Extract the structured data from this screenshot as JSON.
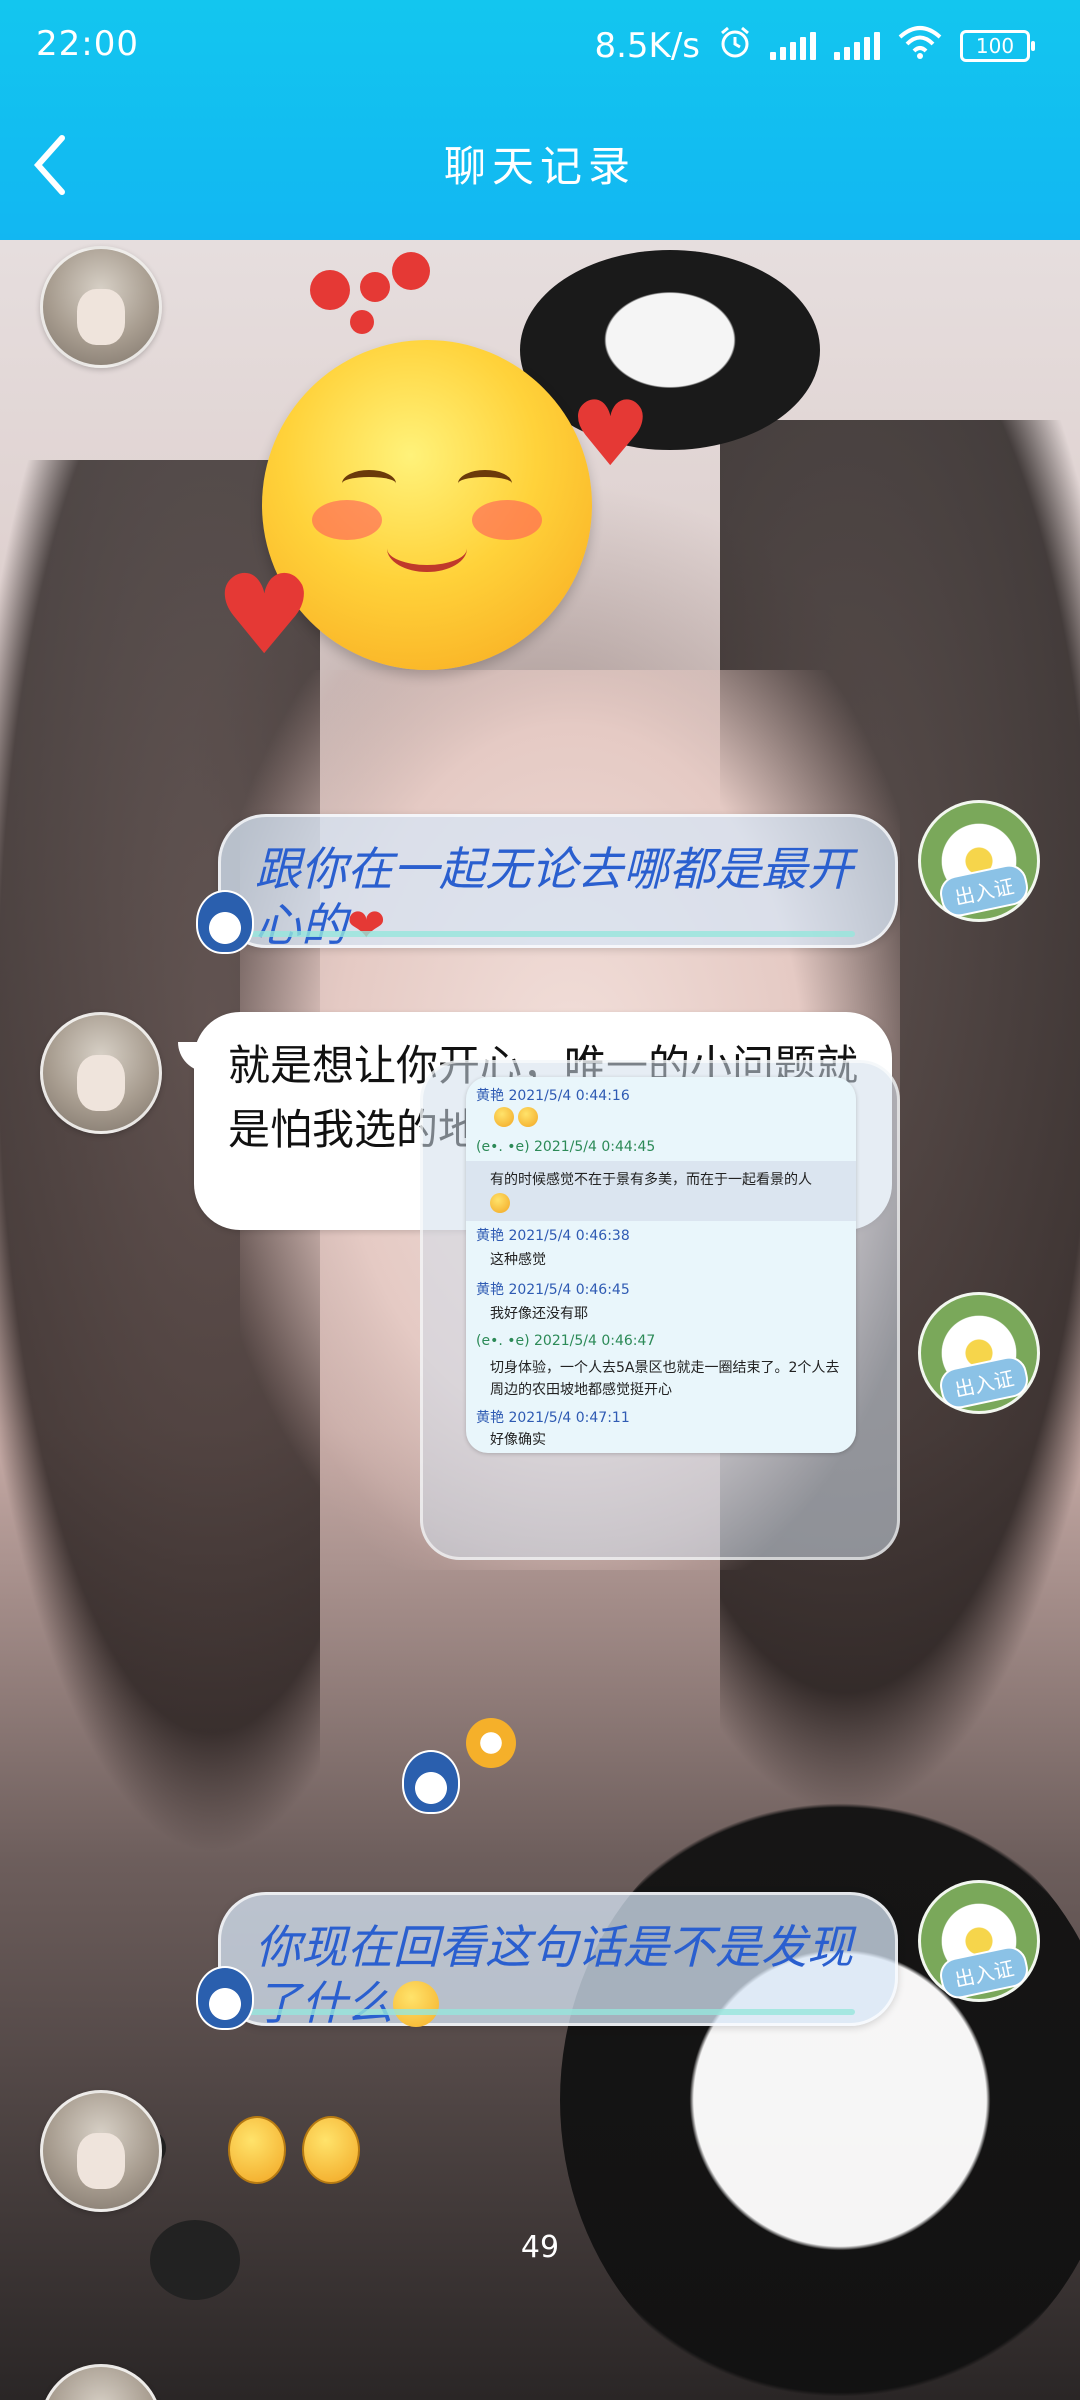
{
  "status_bar": {
    "time": "22:00",
    "net_speed": "8.5K/s",
    "battery": "100"
  },
  "header": {
    "title": "聊天记录"
  },
  "messages": {
    "m1": {
      "text": "跟你在一起无论去哪都是最开心的"
    },
    "m2": {
      "text": "就是想让你开心，唯一的小问题就是怕我选的地踩雷你不喜欢"
    },
    "m4": {
      "text": "你现在回看这句话是不是发现了什么"
    }
  },
  "screenshot": {
    "rows": [
      {
        "kind": "a",
        "text": "黄艳 2021/5/4 0:44:16"
      },
      {
        "kind": "b",
        "text": "(e•. •e) 2021/5/4 0:44:45"
      },
      {
        "kind": "t",
        "text": "有的时候感觉不在于景有多美，而在于一起看景的人"
      },
      {
        "kind": "a",
        "text": "黄艳 2021/5/4 0:46:38"
      },
      {
        "kind": "t",
        "text": "这种感觉"
      },
      {
        "kind": "a",
        "text": "黄艳 2021/5/4 0:46:45"
      },
      {
        "kind": "t",
        "text": "我好像还没有耶"
      },
      {
        "kind": "b",
        "text": "(e•. •e) 2021/5/4 0:46:47"
      },
      {
        "kind": "t",
        "text": "切身体验，一个人去5A景区也就走一圈结束了。2个人去"
      },
      {
        "kind": "t",
        "text": "周边的农田坡地都感觉挺开心"
      },
      {
        "kind": "a",
        "text": "黄艳 2021/5/4 0:47:11"
      },
      {
        "kind": "t",
        "text": "好像确实"
      }
    ]
  },
  "badges": {
    "pass": "出入证"
  },
  "time_hint": "49",
  "colors": {
    "header": "#13c6ef",
    "sent_text": "#2a5fcf",
    "received_bubble": "#ffffff"
  }
}
